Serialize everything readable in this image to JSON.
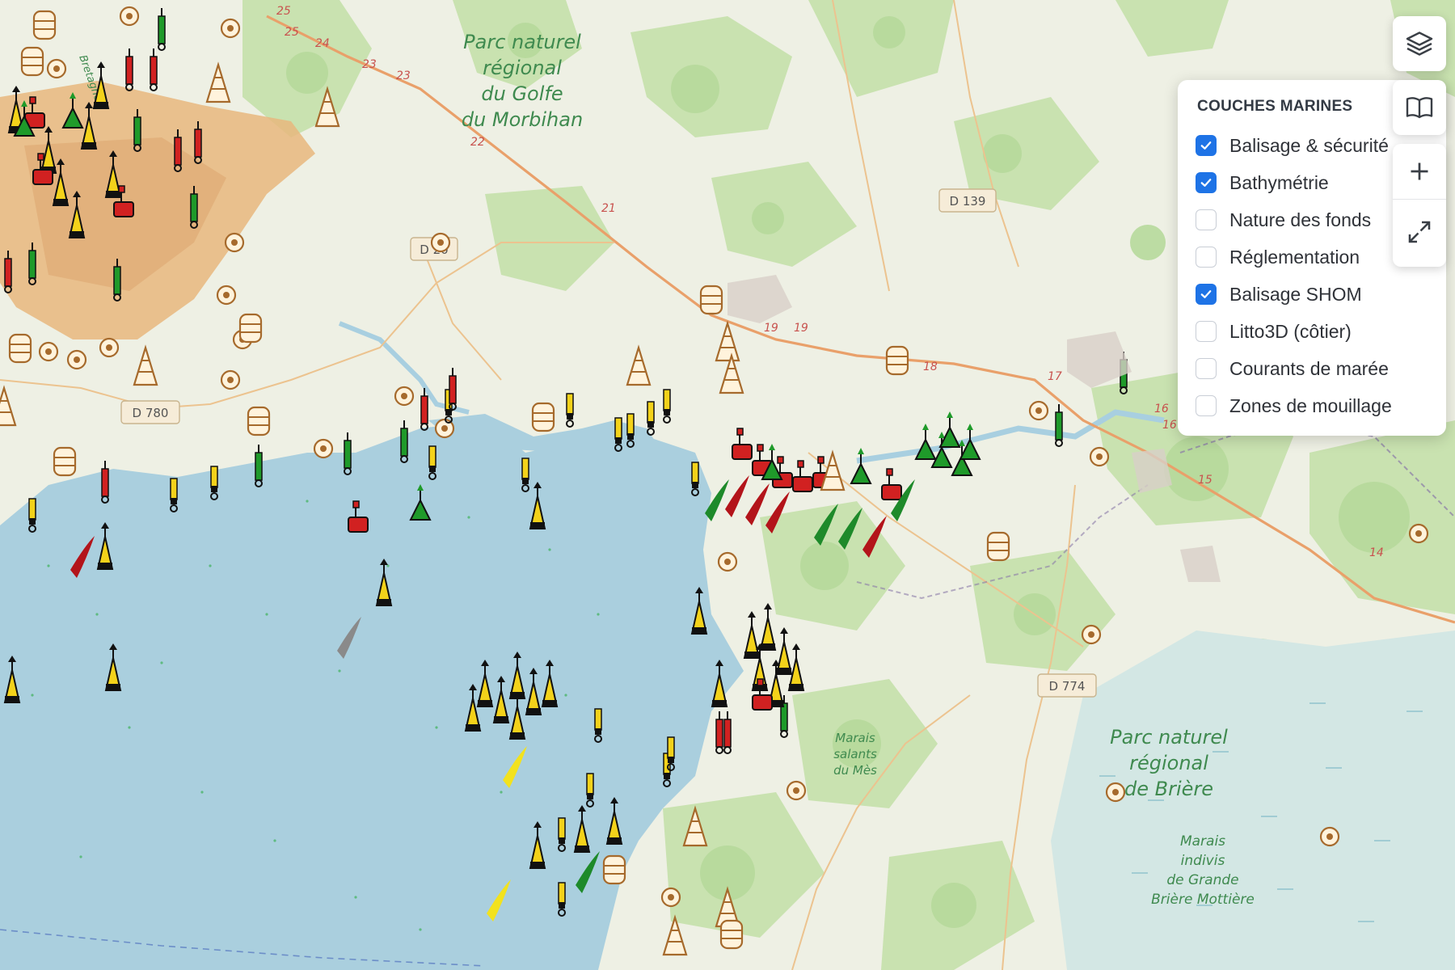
{
  "map": {
    "labels": {
      "parc_morbihan": [
        "Parc naturel",
        "régional",
        "du Golfe",
        "du Morbihan"
      ],
      "parc_briere": [
        "Parc naturel",
        "régional",
        "de Brière"
      ],
      "marais_salants": [
        "Marais",
        "salants",
        "du Mès"
      ],
      "marais_indivis": [
        "Marais",
        "indivis",
        "de Grande",
        "Brière Mottière"
      ],
      "bretagne": "Bretagne"
    },
    "roads": {
      "d780": "D 780",
      "d20": "D 20",
      "d139": "D 139",
      "d774": "D 774"
    },
    "km_markers": [
      "25",
      "25",
      "24",
      "23",
      "23",
      "22",
      "21",
      "19",
      "19",
      "18",
      "17",
      "16",
      "16",
      "15",
      "14"
    ],
    "colors": {
      "sea": "#aacfde",
      "land": "#eef0e4",
      "forest": "#c9e2b0",
      "river": "#a8cfe0",
      "road": "#e9a06a",
      "buoy_yellow": "#f3d21a",
      "buoy_red": "#d12121",
      "buoy_green": "#1f9a2a",
      "accent": "#1e73e6"
    }
  },
  "layers_panel": {
    "title": "COUCHES MARINES",
    "layers": [
      {
        "label": "Balisage & sécurité",
        "checked": true
      },
      {
        "label": "Bathymétrie",
        "checked": true
      },
      {
        "label": "Nature des fonds",
        "checked": false
      },
      {
        "label": "Réglementation",
        "checked": false
      },
      {
        "label": "Balisage SHOM",
        "checked": true
      },
      {
        "label": "Litto3D (côtier)",
        "checked": false
      },
      {
        "label": "Courants de marée",
        "checked": false
      },
      {
        "label": "Zones de mouillage",
        "checked": false
      }
    ]
  },
  "controls": {
    "layers_icon": "layers-icon",
    "book_icon": "book-open-icon",
    "zoom_in_icon": "plus-icon",
    "fullscreen_icon": "expand-icon"
  }
}
